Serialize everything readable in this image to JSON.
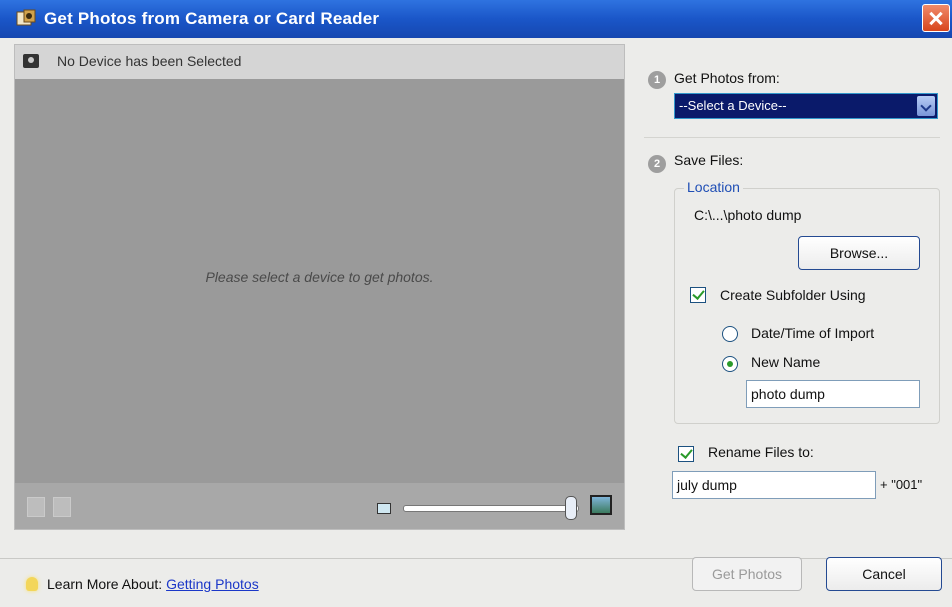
{
  "window": {
    "title": "Get Photos from Camera or Card Reader",
    "icon": "camera-app-icon",
    "close_icon": "close-icon",
    "title_color": "#1a56c8"
  },
  "preview": {
    "device_status": "No Device has been Selected",
    "placeholder": "Please select a device to get photos."
  },
  "step1": {
    "number": "1",
    "label": "Get Photos from:",
    "device_select": "--Select a Device--"
  },
  "step2": {
    "number": "2",
    "label": "Save Files:",
    "location_legend": "Location",
    "path": "C:\\...\\photo dump",
    "browse_label": "Browse...",
    "create_subfolder_label": "Create Subfolder Using",
    "create_subfolder_checked": true,
    "radio_date_label": "Date/Time of Import",
    "radio_name_label": "New Name",
    "selected_option": "New Name",
    "subfolder_name_value": "photo dump",
    "rename_label": "Rename Files to:",
    "rename_checked": true,
    "rename_value": "july dump",
    "rename_suffix": "+ \"001\""
  },
  "footer": {
    "learn_prefix": "Learn More About:",
    "learn_link": "Getting Photos",
    "get_photos_label": "Get Photos",
    "cancel_label": "Cancel"
  }
}
